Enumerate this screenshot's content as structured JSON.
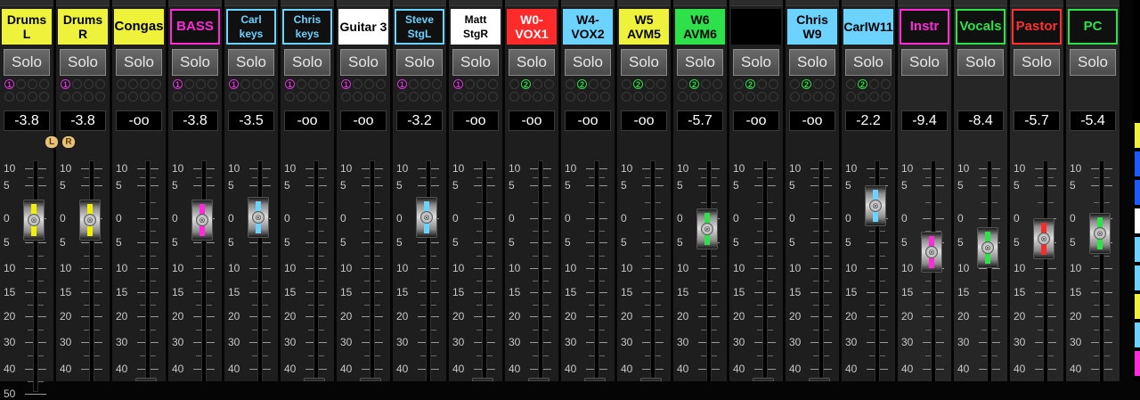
{
  "channels": [
    {
      "name": "Drums L",
      "bg": "#eef23a",
      "fg": "#000000",
      "solo": "Solo",
      "bus": "1",
      "gain": "-3.8",
      "fader": 0.18,
      "color": "#f0f000",
      "lr": true
    },
    {
      "name": "Drums R",
      "bg": "#eef23a",
      "fg": "#000000",
      "solo": "Solo",
      "bus": "1",
      "gain": "-3.8",
      "fader": 0.18,
      "color": "#f0f000"
    },
    {
      "name": "Congas",
      "bg": "#eef23a",
      "fg": "#000000",
      "solo": "Solo",
      "bus": "",
      "gain": "-oo",
      "fader": 0.95,
      "color": "#f0f000"
    },
    {
      "name": "BASS",
      "bg": "#101010",
      "fg": "#ff2ad8",
      "border": "#ff2ad8",
      "solo": "Solo",
      "bus": "1",
      "gain": "-3.8",
      "fader": 0.18,
      "color": "#ff2ad8"
    },
    {
      "name": "Carl keys",
      "bg": "#101010",
      "fg": "#6cd2ff",
      "border": "#6cd2ff",
      "solo": "Solo",
      "bus": "1",
      "gain": "-3.5",
      "fader": 0.17,
      "color": "#6cd2ff"
    },
    {
      "name": "Chris keys",
      "bg": "#101010",
      "fg": "#6cd2ff",
      "border": "#6cd2ff",
      "solo": "Solo",
      "bus": "1",
      "gain": "-oo",
      "fader": 0.95,
      "color": "#6cd2ff"
    },
    {
      "name": "Guitar 3",
      "bg": "#ffffff",
      "fg": "#000000",
      "solo": "Solo",
      "bus": "1",
      "gain": "-oo",
      "fader": 0.95,
      "color": "#ffffff"
    },
    {
      "name": "Steve StgL",
      "bg": "#101010",
      "fg": "#6cd2ff",
      "border": "#6cd2ff",
      "solo": "Solo",
      "bus": "1",
      "gain": "-3.2",
      "fader": 0.17,
      "color": "#6cd2ff"
    },
    {
      "name": "Matt StgR",
      "bg": "#ffffff",
      "fg": "#000000",
      "solo": "Solo",
      "bus": "1",
      "gain": "-oo",
      "fader": 0.95,
      "color": "#ffffff"
    },
    {
      "name": "W0-VOX1",
      "bg": "#ff2a2a",
      "fg": "#ffffff",
      "solo": "Solo",
      "bus": "2",
      "gain": "-oo",
      "fader": 0.95,
      "color": "#ff2a2a"
    },
    {
      "name": "W4-VOX2",
      "bg": "#6cd2ff",
      "fg": "#000000",
      "solo": "Solo",
      "bus": "2",
      "gain": "-oo",
      "fader": 0.95,
      "color": "#6cd2ff"
    },
    {
      "name": "W5 AVM5",
      "bg": "#eef23a",
      "fg": "#000000",
      "solo": "Solo",
      "bus": "2",
      "gain": "-oo",
      "fader": 0.95,
      "color": "#f0f000"
    },
    {
      "name": "W6 AVM6",
      "bg": "#2ee04a",
      "fg": "#000000",
      "solo": "Solo",
      "bus": "2",
      "gain": "-5.7",
      "fader": 0.22,
      "color": "#2ee04a"
    },
    {
      "name": "",
      "bg": "#000000",
      "fg": "#ffffff",
      "solo": "Solo",
      "bus": "2",
      "gain": "-oo",
      "fader": 0.95,
      "color": "#1a5cff"
    },
    {
      "name": "Chris W9",
      "bg": "#6cd2ff",
      "fg": "#000000",
      "solo": "Solo",
      "bus": "2",
      "gain": "-oo",
      "fader": 0.95,
      "color": "#6cd2ff"
    },
    {
      "name": "CarlW11",
      "bg": "#6cd2ff",
      "fg": "#000000",
      "solo": "Solo",
      "bus": "2",
      "gain": "-2.2",
      "fader": 0.12,
      "color": "#6cd2ff"
    },
    {
      "name": "Instr",
      "bg": "#101010",
      "fg": "#ff2ad8",
      "border": "#ff2ad8",
      "solo": "Solo",
      "bus": "",
      "gain": "-9.4",
      "fader": 0.32,
      "color": "#ff2ad8",
      "dark": true
    },
    {
      "name": "Vocals",
      "bg": "#101010",
      "fg": "#2ee04a",
      "border": "#2ee04a",
      "solo": "Solo",
      "bus": "",
      "gain": "-8.4",
      "fader": 0.3,
      "color": "#2ee04a",
      "dark": true
    },
    {
      "name": "Pastor",
      "bg": "#101010",
      "fg": "#ff3030",
      "border": "#ff3030",
      "solo": "Solo",
      "bus": "",
      "gain": "-5.7",
      "fader": 0.26,
      "color": "#ff2a2a",
      "dark": true
    },
    {
      "name": "PC",
      "bg": "#101010",
      "fg": "#2ee04a",
      "border": "#2ee04a",
      "solo": "Solo",
      "bus": "",
      "gain": "-5.4",
      "fader": 0.24,
      "color": "#2ee04a",
      "dark": true
    }
  ],
  "scale": [
    "10",
    "5",
    "0",
    "5",
    "10",
    "15",
    "20",
    "30",
    "40",
    "50"
  ],
  "lr_labels": [
    "L",
    "R"
  ],
  "side_swatches": [
    "#eef23a",
    "#1a5cff",
    "#1a5cff",
    "#ffffff",
    "#6cd2ff",
    "#6cd2ff",
    "#eef23a",
    "#6cd2ff",
    "#ff2ad8"
  ],
  "bus_colors": {
    "1": "#d83ad8",
    "2": "#2ee04a"
  }
}
